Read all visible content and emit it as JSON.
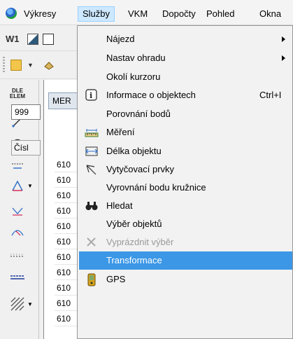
{
  "menubar": {
    "items": [
      "Výkresy",
      "Služby",
      "VKM",
      "Dopočty",
      "Pohled",
      "Okna"
    ],
    "active_index": 1
  },
  "toolbar": {
    "w1_label": "W1"
  },
  "left_toolbar": {
    "dle_line1": "DLE",
    "dle_line2": "ELEM"
  },
  "document": {
    "tab_label": "MER",
    "filter_value": "999",
    "column_header": "Čísl",
    "rows": [
      "610",
      "610",
      "610",
      "610",
      "610",
      "610",
      "610",
      "610",
      "610",
      "610",
      "610"
    ]
  },
  "services_menu": {
    "items": [
      {
        "label": "Nájezd",
        "shortcut": "",
        "submenu": true,
        "icon": "",
        "disabled": false,
        "highlighted": false
      },
      {
        "label": "Nastav ohradu",
        "shortcut": "",
        "submenu": true,
        "icon": "",
        "disabled": false,
        "highlighted": false
      },
      {
        "label": "Okolí kurzoru",
        "shortcut": "",
        "submenu": false,
        "icon": "",
        "disabled": false,
        "highlighted": false
      },
      {
        "label": "Informace o objektech",
        "shortcut": "Ctrl+I",
        "submenu": false,
        "icon": "info-icon",
        "disabled": false,
        "highlighted": false
      },
      {
        "label": "Porovnání bodů",
        "shortcut": "",
        "submenu": false,
        "icon": "",
        "disabled": false,
        "highlighted": false
      },
      {
        "label": "Měření",
        "shortcut": "",
        "submenu": false,
        "icon": "ruler-icon",
        "disabled": false,
        "highlighted": false
      },
      {
        "label": "Délka objektu",
        "shortcut": "",
        "submenu": false,
        "icon": "length-icon",
        "disabled": false,
        "highlighted": false
      },
      {
        "label": "Vytyčovací prvky",
        "shortcut": "",
        "submenu": false,
        "icon": "stakeout-icon",
        "disabled": false,
        "highlighted": false
      },
      {
        "label": "Vyrovnání bodu kružnice",
        "shortcut": "",
        "submenu": false,
        "icon": "",
        "disabled": false,
        "highlighted": false
      },
      {
        "label": "Hledat",
        "shortcut": "",
        "submenu": false,
        "icon": "binoculars-icon",
        "disabled": false,
        "highlighted": false
      },
      {
        "label": "Výběr objektů",
        "shortcut": "",
        "submenu": false,
        "icon": "",
        "disabled": false,
        "highlighted": false
      },
      {
        "label": "Vyprázdnit výběr",
        "shortcut": "",
        "submenu": false,
        "icon": "clear-cross-icon",
        "disabled": true,
        "highlighted": false
      },
      {
        "label": "Transformace",
        "shortcut": "",
        "submenu": false,
        "icon": "",
        "disabled": false,
        "highlighted": true
      },
      {
        "label": "GPS",
        "shortcut": "",
        "submenu": false,
        "icon": "gps-device-icon",
        "disabled": false,
        "highlighted": false
      }
    ]
  },
  "colors": {
    "highlight": "#3c97e6",
    "active_menu_bg": "#cde8ff",
    "disabled_text": "#9a9a9a"
  }
}
